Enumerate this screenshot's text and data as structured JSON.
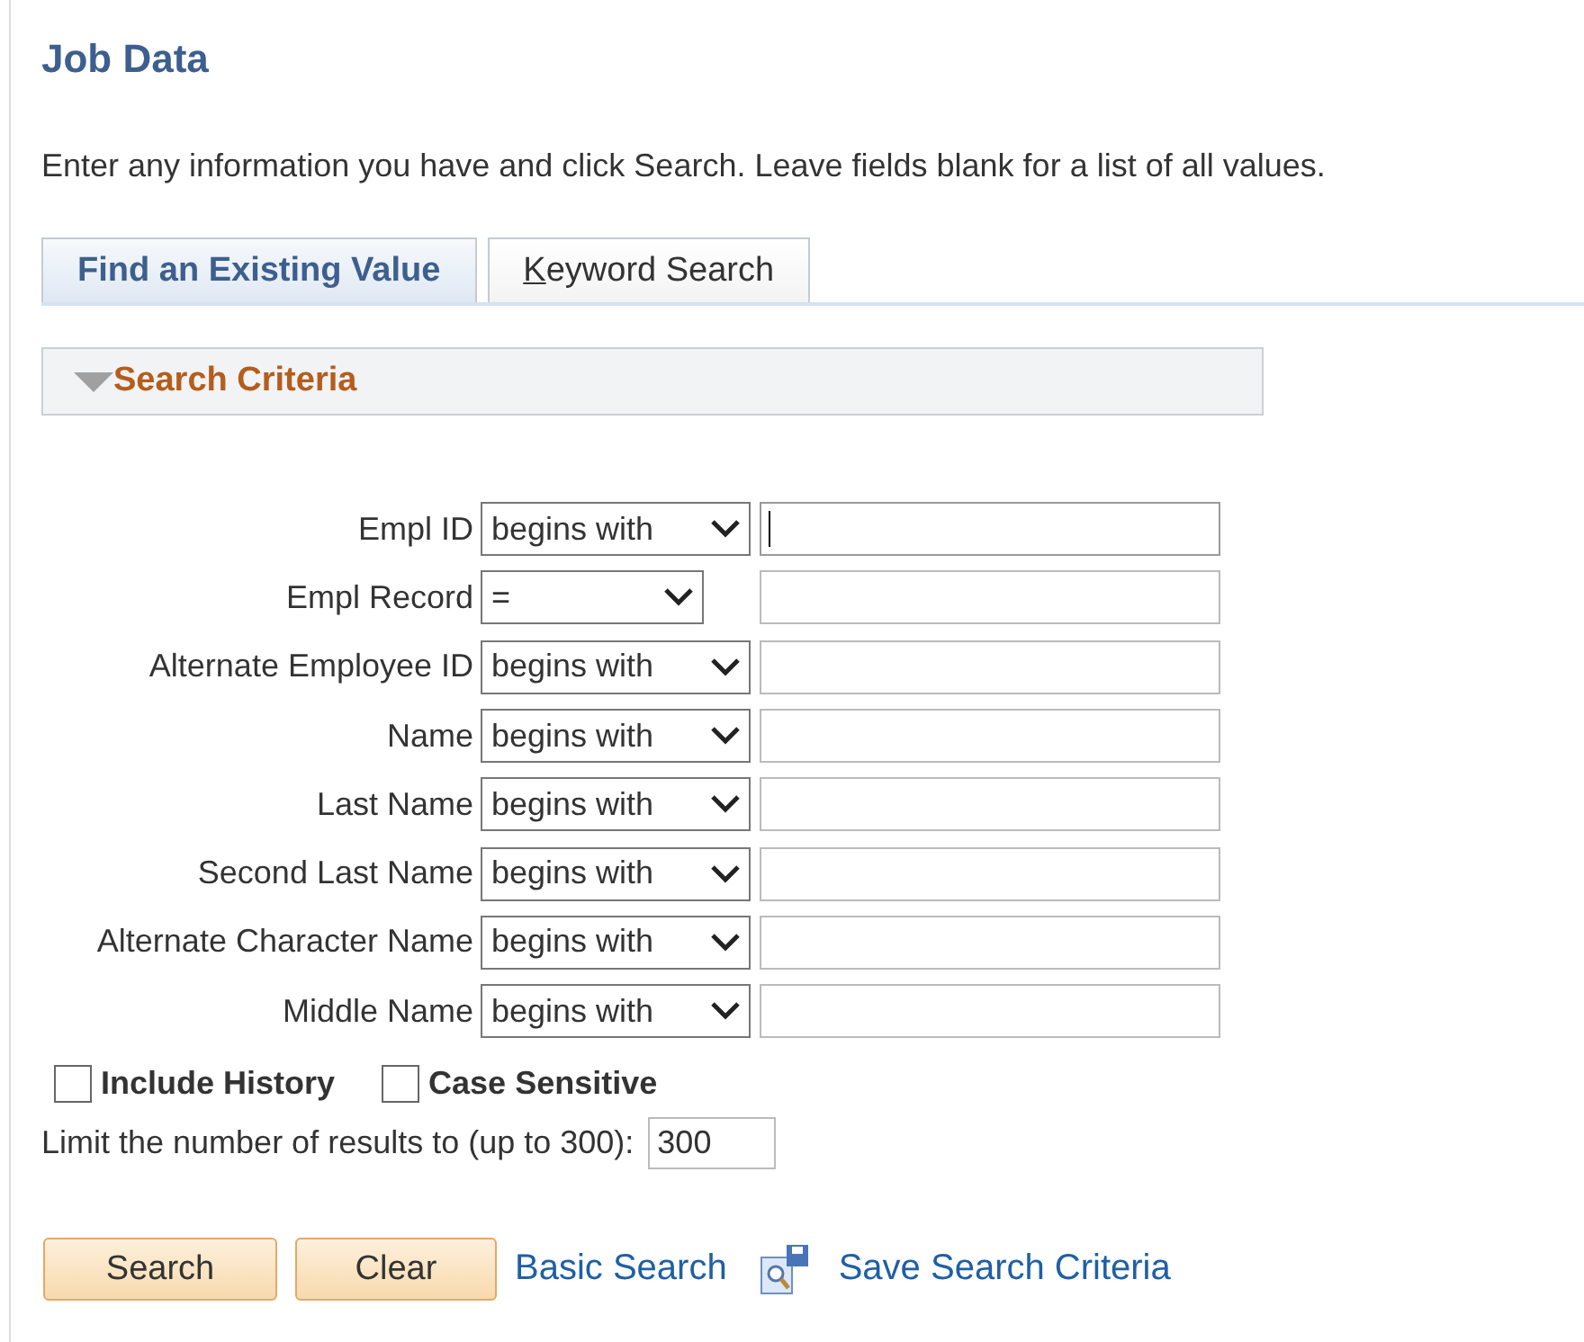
{
  "title": "Job Data",
  "instructions": "Enter any information you have and click Search. Leave fields blank for a list of all values.",
  "tabs": [
    {
      "label": "Find an Existing Value",
      "selected": true,
      "access_key_underlined": false
    },
    {
      "label": "Keyword Search",
      "selected": false,
      "access_key_underlined": true
    }
  ],
  "section": {
    "title": "Search Criteria",
    "expanded": true
  },
  "fields": [
    {
      "label": "Empl ID",
      "operator": "begins with",
      "kind": "text",
      "focused": true
    },
    {
      "label": "Empl Record",
      "operator": "=",
      "kind": "number",
      "focused": false
    },
    {
      "label": "Alternate Employee ID",
      "operator": "begins with",
      "kind": "text",
      "focused": false
    },
    {
      "label": "Name",
      "operator": "begins with",
      "kind": "text",
      "focused": false
    },
    {
      "label": "Last Name",
      "operator": "begins with",
      "kind": "text",
      "focused": false
    },
    {
      "label": "Second Last Name",
      "operator": "begins with",
      "kind": "text",
      "focused": false
    },
    {
      "label": "Alternate Character Name",
      "operator": "begins with",
      "kind": "text",
      "focused": false
    },
    {
      "label": "Middle Name",
      "operator": "begins with",
      "kind": "text",
      "focused": false
    }
  ],
  "options": [
    {
      "label": "Include History",
      "checked": false
    },
    {
      "label": "Case Sensitive",
      "checked": false
    }
  ],
  "limit": {
    "label": "Limit the number of results to (up to 300):",
    "value": "300"
  },
  "buttons": [
    "Search",
    "Clear"
  ],
  "links": [
    {
      "label": "Basic Search",
      "kind": "plain"
    },
    {
      "label": "Save Search Criteria",
      "kind": "save"
    }
  ]
}
